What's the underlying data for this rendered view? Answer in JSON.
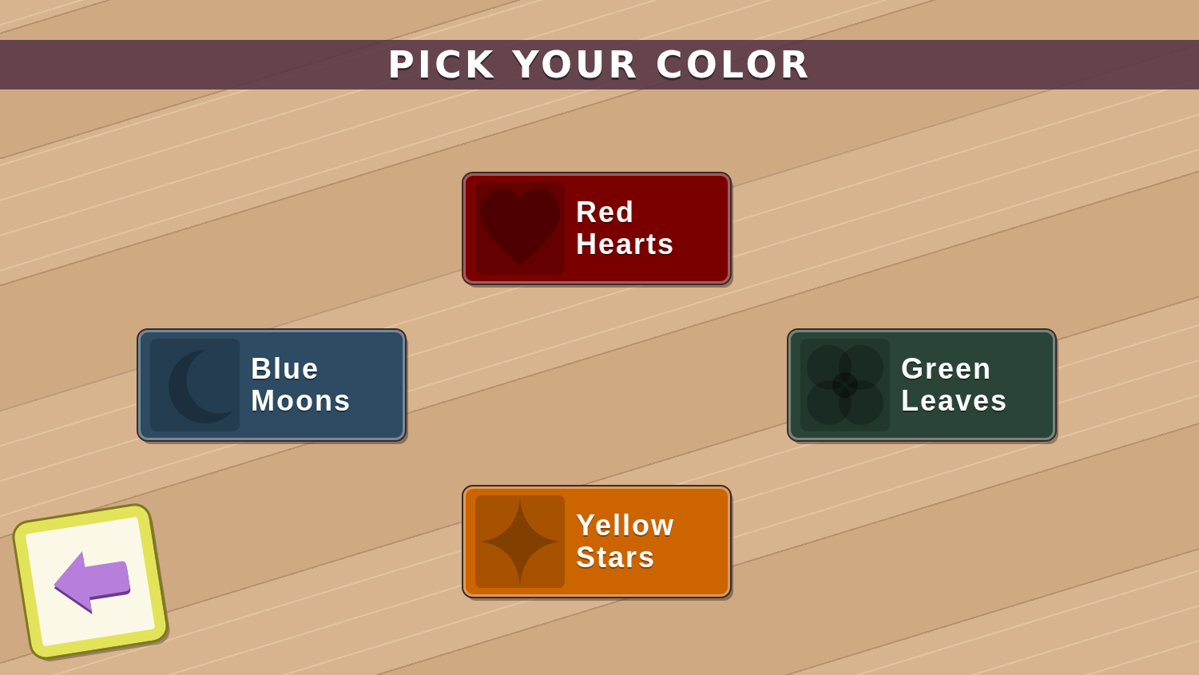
{
  "title": "PICK YOUR COLOR",
  "options": [
    {
      "label": "Red Hearts",
      "kind": "heart",
      "color": "#7a0000"
    },
    {
      "label": "Blue Moons",
      "kind": "moon",
      "color": "#2d4b62"
    },
    {
      "label": "Green Leaves",
      "kind": "flower",
      "color": "#2a4538"
    },
    {
      "label": "Yellow Stars",
      "kind": "star",
      "color": "#cc6400"
    }
  ]
}
